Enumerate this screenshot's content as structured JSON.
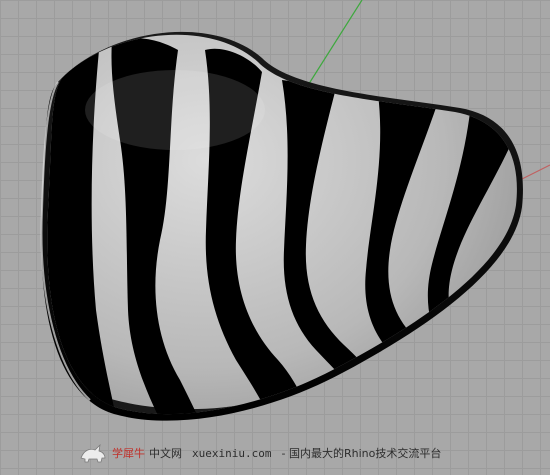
{
  "viewport": {
    "background_color": "#a8a8a8",
    "grid_color": "#9c9c9c",
    "axis_colors": {
      "x": "#c06060",
      "y": "#3ea83e"
    }
  },
  "model": {
    "shape": "heart-shaped dish",
    "analysis": "zebra stripes",
    "colors": {
      "stripe_dark": "#000000",
      "stripe_light": "#c8c8c8"
    }
  },
  "watermark": {
    "brand_text": "学犀牛",
    "site_text": "中文网",
    "url": "xuexiniu.com",
    "slogan": "- 国内最大的Rhino技术交流平台",
    "logo_icon": "rhino-logo-icon",
    "brand_color": "#c0302a"
  }
}
